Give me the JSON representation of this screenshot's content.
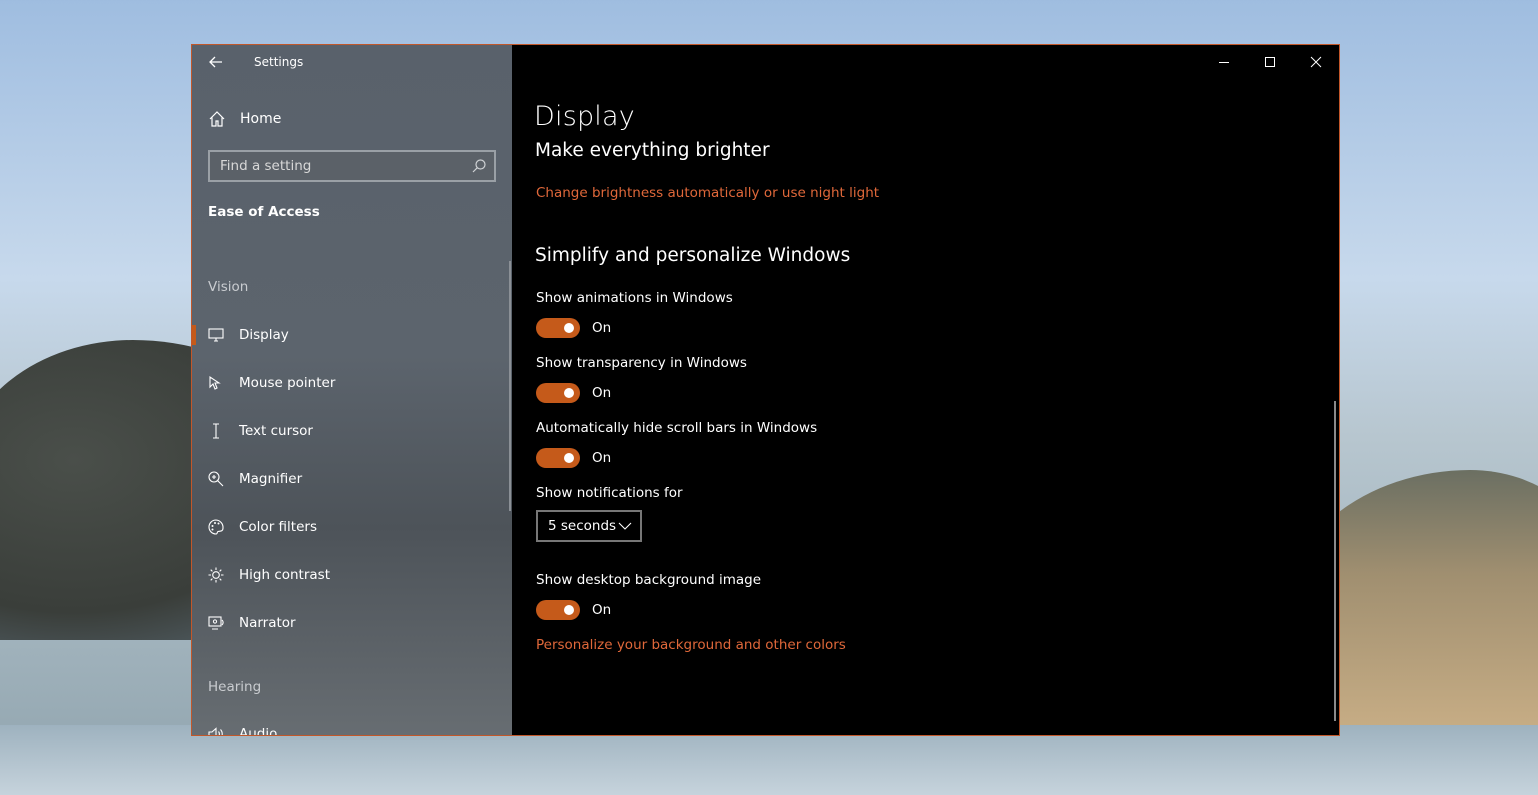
{
  "window": {
    "title": "Settings"
  },
  "sidebar": {
    "home_label": "Home",
    "search_placeholder": "Find a setting",
    "section_title": "Ease of Access",
    "vision_group": "Vision",
    "hearing_group": "Hearing",
    "items": [
      {
        "label": "Display",
        "icon": "monitor-icon",
        "active": true
      },
      {
        "label": "Mouse pointer",
        "icon": "mouse-pointer-icon"
      },
      {
        "label": "Text cursor",
        "icon": "text-cursor-icon"
      },
      {
        "label": "Magnifier",
        "icon": "magnifier-icon"
      },
      {
        "label": "Color filters",
        "icon": "palette-icon"
      },
      {
        "label": "High contrast",
        "icon": "sun-icon"
      },
      {
        "label": "Narrator",
        "icon": "narrator-icon"
      }
    ],
    "hearing_items": [
      {
        "label": "Audio",
        "icon": "speaker-icon"
      }
    ]
  },
  "main": {
    "page_title": "Display",
    "brighter_heading": "Make everything brighter",
    "brightness_link": "Change brightness automatically or use night light",
    "simplify_heading": "Simplify and personalize Windows",
    "animations": {
      "label": "Show animations in Windows",
      "state": "On"
    },
    "transparency": {
      "label": "Show transparency in Windows",
      "state": "On"
    },
    "scrollbars": {
      "label": "Automatically hide scroll bars in Windows",
      "state": "On"
    },
    "notifications": {
      "label": "Show notifications for",
      "value": "5 seconds"
    },
    "background": {
      "label": "Show desktop background image",
      "state": "On"
    },
    "personalize_link": "Personalize your background and other colors"
  },
  "colors": {
    "accent": "#c55a1a",
    "link": "#e0683a",
    "content_bg": "#000000"
  }
}
